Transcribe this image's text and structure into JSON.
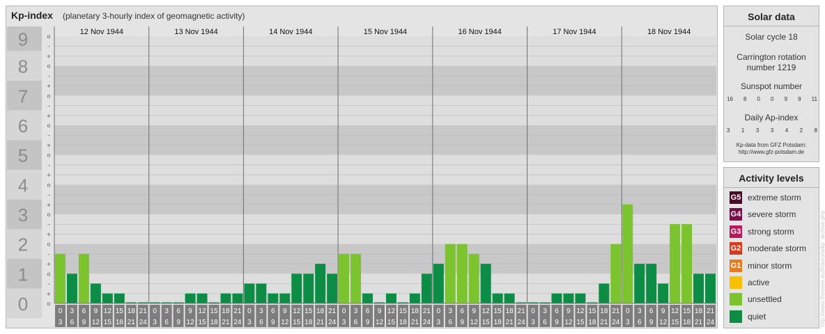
{
  "header": {
    "title": "Kp-index",
    "subtitle": "(planetary 3-hourly index of geomagnetic activity)"
  },
  "chart_data": {
    "type": "bar",
    "ylim": [
      0,
      9
    ],
    "y_major_ticks": [
      "0",
      "1",
      "2",
      "3",
      "4",
      "5",
      "6",
      "7",
      "8",
      "9"
    ],
    "y_minor_ticks": [
      "o",
      "+",
      "–",
      "o",
      "+",
      "–",
      "o",
      "+",
      "–",
      "o",
      "+",
      "–",
      "o",
      "+",
      "–",
      "o",
      "+",
      "–",
      "o",
      "+",
      "–",
      "o",
      "+",
      "–",
      "o",
      "+",
      "–",
      "o"
    ],
    "days": [
      "12 Nov 1944",
      "13 Nov 1944",
      "14 Nov 1944",
      "15 Nov 1944",
      "16 Nov 1944",
      "17 Nov 1944",
      "18 Nov 1944"
    ],
    "slot_start_labels": [
      "0",
      "3",
      "6",
      "9",
      "12",
      "15",
      "18",
      "21"
    ],
    "slot_end_labels": [
      "3",
      "6",
      "9",
      "12",
      "15",
      "18",
      "21",
      "24"
    ],
    "values": [
      [
        1.667,
        1.0,
        1.667,
        0.667,
        0.333,
        0.333,
        0.0,
        0.0
      ],
      [
        0.0,
        0.0,
        0.0,
        0.333,
        0.333,
        0.0,
        0.333,
        0.333
      ],
      [
        0.667,
        0.667,
        0.333,
        0.333,
        1.0,
        1.0,
        1.333,
        1.0
      ],
      [
        1.667,
        1.667,
        0.333,
        0.0,
        0.333,
        0.0,
        0.333,
        1.0
      ],
      [
        1.333,
        2.0,
        2.0,
        1.667,
        1.333,
        0.333,
        0.333,
        0.0
      ],
      [
        0.0,
        0.0,
        0.333,
        0.333,
        0.333,
        0.0,
        0.667,
        2.0
      ],
      [
        3.333,
        1.333,
        1.333,
        0.667,
        2.667,
        2.667,
        1.0,
        1.0
      ]
    ],
    "grid": true,
    "legend": "right"
  },
  "solar": {
    "title": "Solar data",
    "cycle": "Solar cycle 18",
    "carrington_line1": "Carrington rotation",
    "carrington_line2": "number 1219",
    "sunspot_label": "Sunspot number",
    "sunspot_values": [
      "16",
      "8",
      "0",
      "0",
      "9",
      "9",
      "11"
    ],
    "ap_label": "Daily Ap-index",
    "ap_values": [
      "3",
      "1",
      "3",
      "3",
      "4",
      "2",
      "8"
    ],
    "credit_line1": "Kp-data from GFZ Potsdam:",
    "credit_line2": "http://www.gfz-potsdam.de"
  },
  "activity": {
    "title": "Activity levels",
    "levels": [
      {
        "badge": "G5",
        "label": "extreme storm",
        "color": "#4a0a2a"
      },
      {
        "badge": "G4",
        "label": "severe storm",
        "color": "#7a0f4a"
      },
      {
        "badge": "G3",
        "label": "strong storm",
        "color": "#b81a5e"
      },
      {
        "badge": "G2",
        "label": "moderate storm",
        "color": "#d83a1e"
      },
      {
        "badge": "G1",
        "label": "minor storm",
        "color": "#e87a1a"
      },
      {
        "badge": "",
        "label": "active",
        "color": "#f8c000"
      },
      {
        "badge": "",
        "label": "unsettled",
        "color": "#7cc42e"
      },
      {
        "badge": "",
        "label": "quiet",
        "color": "#0c8c44"
      }
    ]
  },
  "watermark": "http://www.theusee.eu/fr/aurora/kp_archive.php",
  "colors": {
    "quiet": "#0c8c44",
    "unsettled": "#7cc42e",
    "band_dark": "#c8c8c8",
    "band_light": "#dedede",
    "axis_gray": "#8c8c8c"
  }
}
